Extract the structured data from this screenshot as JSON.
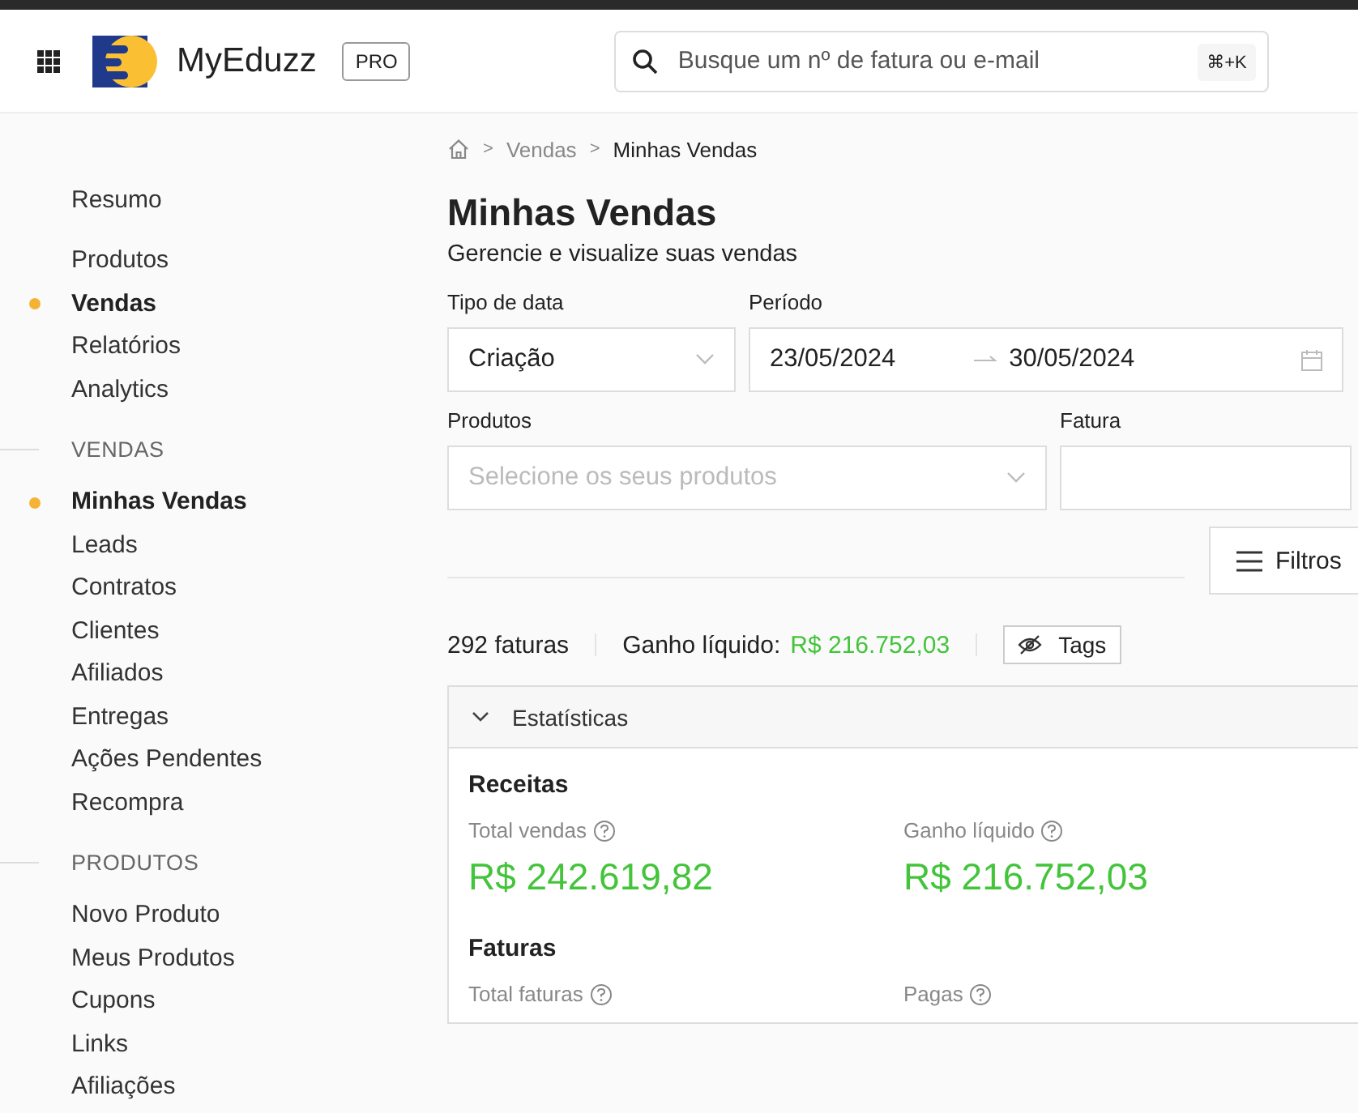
{
  "header": {
    "brand": "MyEduzz",
    "plan": "PRO",
    "search": {
      "placeholder": "Busque um nº de fatura ou e-mail",
      "shortcut": "⌘+K"
    }
  },
  "sidebar": {
    "groups": [
      {
        "items": [
          {
            "label": "Resumo",
            "selected": false
          }
        ]
      },
      {
        "items": [
          {
            "label": "Produtos",
            "selected": false
          },
          {
            "label": "Vendas",
            "selected": true
          },
          {
            "label": "Relatórios",
            "selected": false
          },
          {
            "label": "Analytics",
            "selected": false
          }
        ]
      },
      {
        "heading": "VENDAS",
        "items": [
          {
            "label": "Minhas Vendas",
            "selected": true
          },
          {
            "label": "Leads",
            "selected": false
          },
          {
            "label": "Contratos",
            "selected": false
          },
          {
            "label": "Clientes",
            "selected": false
          },
          {
            "label": "Afiliados",
            "selected": false
          },
          {
            "label": "Entregas",
            "selected": false
          },
          {
            "label": "Ações Pendentes",
            "selected": false
          },
          {
            "label": "Recompra",
            "selected": false
          }
        ]
      },
      {
        "heading": "PRODUTOS",
        "items": [
          {
            "label": "Novo Produto",
            "selected": false
          },
          {
            "label": "Meus Produtos",
            "selected": false
          },
          {
            "label": "Cupons",
            "selected": false
          },
          {
            "label": "Links",
            "selected": false
          },
          {
            "label": "Afiliações",
            "selected": false
          }
        ]
      }
    ]
  },
  "breadcrumb": {
    "separator": ">",
    "items": [
      "Vendas",
      "Minhas Vendas"
    ]
  },
  "page": {
    "title": "Minhas Vendas",
    "subtitle": "Gerencie e visualize suas vendas"
  },
  "filters": {
    "date_type": {
      "label": "Tipo de data",
      "value": "Criação"
    },
    "period": {
      "label": "Período",
      "start": "23/05/2024",
      "end": "30/05/2024"
    },
    "products": {
      "label": "Produtos",
      "placeholder": "Selecione os seus produtos"
    },
    "invoice": {
      "label": "Fatura"
    },
    "more_button": "Filtros"
  },
  "summary": {
    "count": "292 faturas",
    "net_label": "Ganho líquido:",
    "net_value": "R$ 216.752,03",
    "tags_button": "Tags"
  },
  "stats": {
    "title": "Estatísticas",
    "expanded": true,
    "sections": [
      {
        "title": "Receitas",
        "metrics": [
          {
            "label": "Total vendas",
            "value": "R$ 242.619,82"
          },
          {
            "label": "Ganho líquido",
            "value": "R$ 216.752,03"
          }
        ]
      },
      {
        "title": "Faturas",
        "metrics": [
          {
            "label": "Total faturas"
          },
          {
            "label": "Pagas"
          }
        ]
      }
    ]
  }
}
